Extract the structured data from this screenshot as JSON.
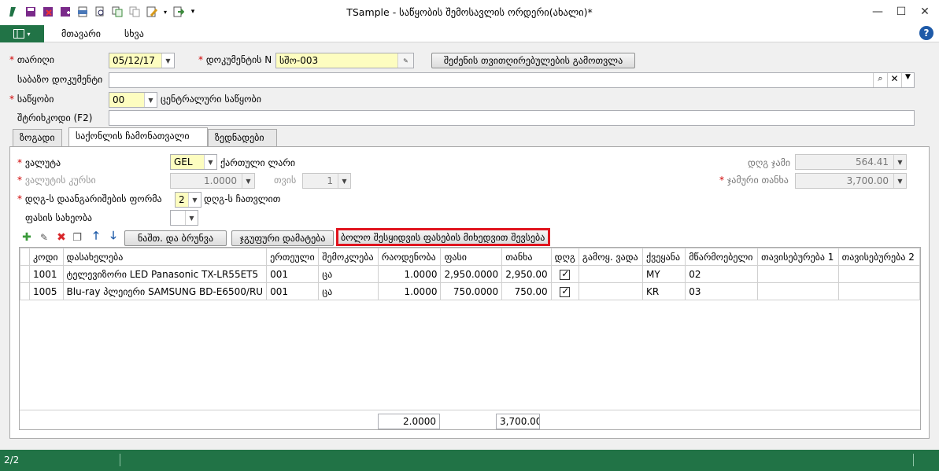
{
  "window": {
    "title": "TSample - საწყობის შემოსავლის ორდერი(ახალი)*"
  },
  "ribbon": {
    "tabs": [
      "მთავარი",
      "სხვა"
    ],
    "help": "?"
  },
  "header": {
    "date_label": "თარიღი",
    "date_value": "05/12/17",
    "docnum_label": "დოკუმენტის N",
    "docnum_value": "სშო-003",
    "calc_button": "შეძენის თვითღირებულების გამოთვლა",
    "basedoc_label": "საბაზო დოკუმენტი",
    "basedoc_value": "",
    "warehouse_label": "საწყობი",
    "warehouse_code": "00",
    "warehouse_name": "ცენტრალური საწყობი",
    "barcode_label": "შტრიხკოდი (F2)",
    "barcode_value": ""
  },
  "tabs": [
    "ზოგადი",
    "საქონლის ჩამონათვალი",
    "ზედნადები"
  ],
  "active_tab": 1,
  "params": {
    "currency_label": "ვალუტა",
    "currency_value": "GEL",
    "currency_name": "ქართული ლარი",
    "rate_label": "ვალუტის კურსი",
    "rate_value": "1.0000",
    "for_label": "თვის",
    "for_value": "1",
    "vat_form_label": "დღგ-ს დაანგარიშების ფორმა",
    "vat_form_value": "2",
    "vat_form_text": "დღგ-ს ჩათვლით",
    "price_type_label": "ფასის სახეობა",
    "price_type_value": "",
    "vat_total_label": "დღგ ჯამი",
    "vat_total_value": "564.41",
    "total_label": "ჯამური თანხა",
    "total_value": "3,700.00"
  },
  "toolbar": {
    "return_button": "ნაშთ. და ბრუნვა",
    "group_add_button": "ჯგუფური დამატება",
    "last_price_button": "ბოლო შესყიდვის ფასების მიხედვით შევსება"
  },
  "grid": {
    "columns": [
      "კოდი",
      "დასახელება",
      "ერთეული",
      "შემოკლება",
      "რაოდენობა",
      "ფასი",
      "თანხა",
      "დღგ",
      "გამოყ. ვადა",
      "ქვეყანა",
      "მწარმოებელი",
      "თავისებურება 1",
      "თავისებურება 2"
    ],
    "rows": [
      {
        "code": "1001",
        "name": "ტელევიზორი LED Panasonic TX-LR55ET5",
        "unit": "001",
        "short": "ცა",
        "qty": "1.0000",
        "price": "2,950.0000",
        "amount": "2,950.00",
        "vat": true,
        "expiry": "",
        "country": "MY",
        "manufacturer": "02",
        "feat1": "",
        "feat2": ""
      },
      {
        "code": "1005",
        "name": "Blu-ray პლეიერი SAMSUNG BD-E6500/RU",
        "unit": "001",
        "short": "ცა",
        "qty": "1.0000",
        "price": "750.0000",
        "amount": "750.00",
        "vat": true,
        "expiry": "",
        "country": "KR",
        "manufacturer": "03",
        "feat1": "",
        "feat2": ""
      }
    ],
    "total_qty": "2.0000",
    "total_amount": "3,700.00"
  },
  "status": {
    "text": "2/2"
  },
  "colors": {
    "accent": "#217346",
    "highlight_border": "#e0141e",
    "required": "#d00000"
  }
}
